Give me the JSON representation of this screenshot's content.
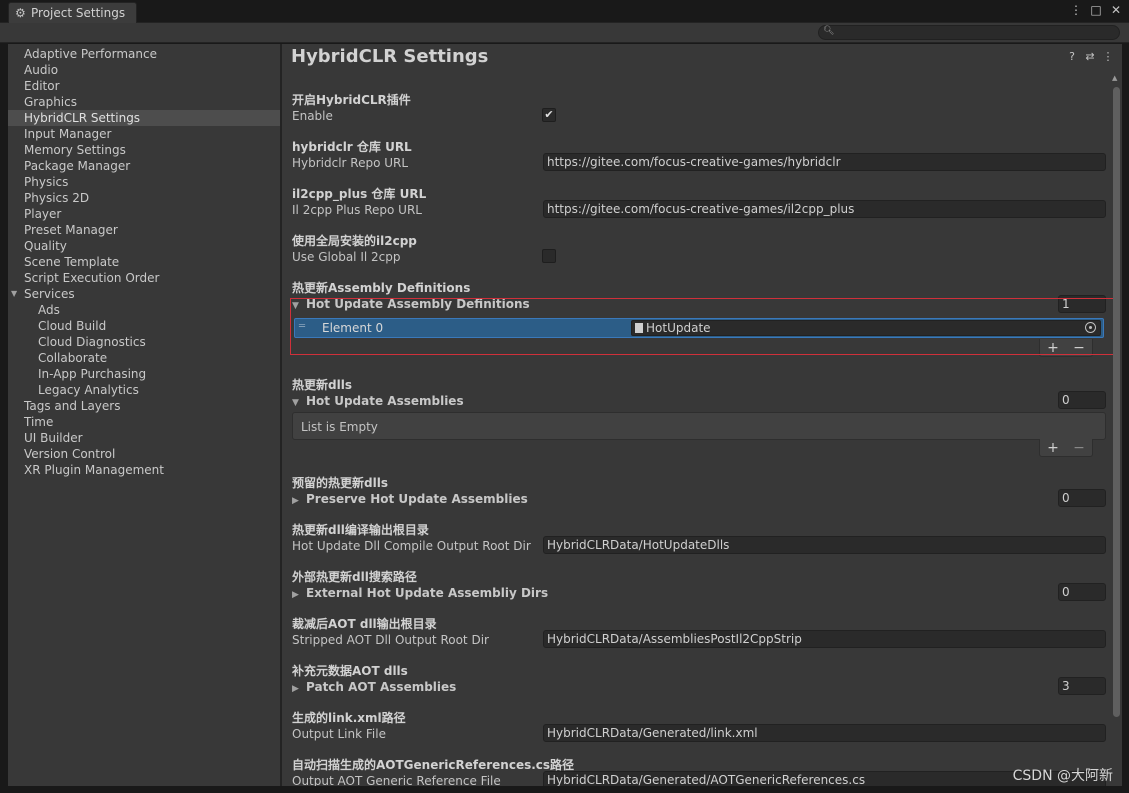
{
  "window": {
    "tab_title": "Project Settings",
    "controls": [
      "⋮",
      "□",
      "✕"
    ]
  },
  "search": {
    "placeholder": ""
  },
  "sidebar": {
    "items": [
      {
        "label": "Adaptive Performance"
      },
      {
        "label": "Audio"
      },
      {
        "label": "Editor"
      },
      {
        "label": "Graphics"
      },
      {
        "label": "HybridCLR Settings",
        "selected": true
      },
      {
        "label": "Input Manager"
      },
      {
        "label": "Memory Settings"
      },
      {
        "label": "Package Manager"
      },
      {
        "label": "Physics"
      },
      {
        "label": "Physics 2D"
      },
      {
        "label": "Player"
      },
      {
        "label": "Preset Manager"
      },
      {
        "label": "Quality"
      },
      {
        "label": "Scene Template"
      },
      {
        "label": "Script Execution Order"
      },
      {
        "label": "Services",
        "expanded": true
      },
      {
        "label": "Ads",
        "sub": true
      },
      {
        "label": "Cloud Build",
        "sub": true
      },
      {
        "label": "Cloud Diagnostics",
        "sub": true
      },
      {
        "label": "Collaborate",
        "sub": true
      },
      {
        "label": "In-App Purchasing",
        "sub": true
      },
      {
        "label": "Legacy Analytics",
        "sub": true
      },
      {
        "label": "Tags and Layers"
      },
      {
        "label": "Time"
      },
      {
        "label": "UI Builder"
      },
      {
        "label": "Version Control"
      },
      {
        "label": "XR Plugin Management"
      }
    ]
  },
  "main": {
    "title": "HybridCLR Settings",
    "enable": {
      "cn": "开启HybridCLR插件",
      "label": "Enable",
      "checked": true,
      "check_glyph": "✔"
    },
    "repo_url": {
      "cn": "hybridclr 仓库 URL",
      "label": "Hybridclr Repo URL",
      "value": "https://gitee.com/focus-creative-games/hybridclr"
    },
    "il2cpp_url": {
      "cn": "il2cpp_plus 仓库 URL",
      "label": "Il 2cpp Plus Repo URL",
      "value": "https://gitee.com/focus-creative-games/il2cpp_plus"
    },
    "global_il2cpp": {
      "cn": "使用全局安装的il2cpp",
      "label": "Use Global Il 2cpp",
      "checked": false
    },
    "hot_update_defs": {
      "cn": "热更新Assembly Definitions",
      "label": "Hot Update Assembly Definitions",
      "count": "1",
      "element_label": "Element 0",
      "element_value": "HotUpdate"
    },
    "hot_update_assemblies": {
      "cn": "热更新dlls",
      "label": "Hot Update Assemblies",
      "count": "0",
      "empty_text": "List is Empty"
    },
    "preserve": {
      "cn": "预留的热更新dlls",
      "label": "Preserve Hot Update Assemblies",
      "count": "0"
    },
    "compile_output": {
      "cn": "热更新dll编译输出根目录",
      "label": "Hot Update Dll Compile Output Root Dir",
      "value": "HybridCLRData/HotUpdateDlls"
    },
    "external_dirs": {
      "cn": "外部热更新dll搜索路径",
      "label": "External Hot Update Assembliy Dirs",
      "count": "0"
    },
    "stripped_output": {
      "cn": "裁减后AOT dll输出根目录",
      "label": "Stripped AOT Dll Output Root Dir",
      "value": "HybridCLRData/AssembliesPostIl2CppStrip"
    },
    "patch_aot": {
      "cn": "补充元数据AOT dlls",
      "label": "Patch AOT Assemblies",
      "count": "3"
    },
    "link_xml": {
      "cn": "生成的link.xml路径",
      "label": "Output Link File",
      "value": "HybridCLRData/Generated/link.xml"
    },
    "aot_generic": {
      "cn": "自动扫描生成的AOTGenericReferences.cs路径",
      "label": "Output AOT Generic Reference File",
      "value": "HybridCLRData/Generated/AOTGenericReferences.cs"
    }
  },
  "list_controls": {
    "plus": "+",
    "minus": "−"
  },
  "watermark": "CSDN @大阿新",
  "colors": {
    "selection": "#2c5d87",
    "highlight_box": "#d0303a",
    "background": "#383838"
  }
}
